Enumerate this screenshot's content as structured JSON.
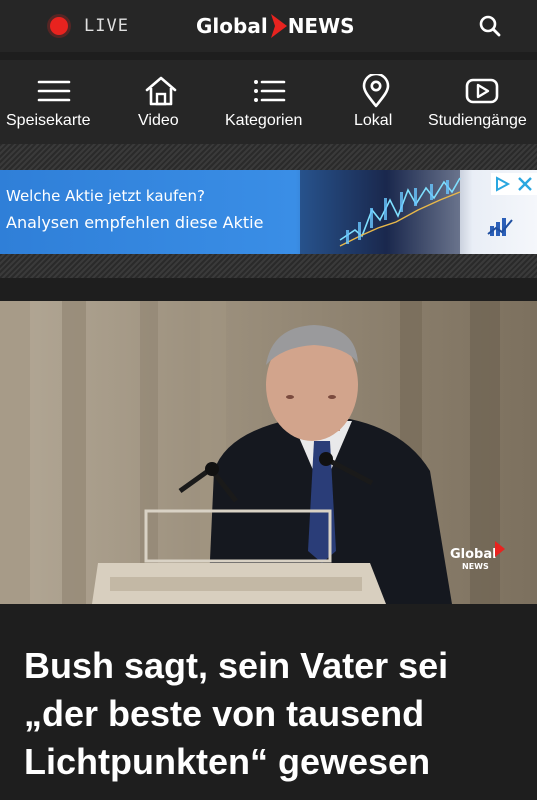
{
  "topbar": {
    "live_label": "LIVE",
    "logo": {
      "left": "Global",
      "right": "NEWS"
    },
    "search_icon": "search-icon"
  },
  "nav": {
    "items": [
      {
        "label": "Speisekarte",
        "icon": "hamburger-menu-icon"
      },
      {
        "label": "Video",
        "icon": "home-icon"
      },
      {
        "label": "Kategorien",
        "icon": "list-icon"
      },
      {
        "label": "Lokal",
        "icon": "location-pin-icon"
      },
      {
        "label": "Studiengänge",
        "icon": "play-icon"
      }
    ]
  },
  "ad": {
    "line1": "Welche Aktie jetzt kaufen?",
    "line2": "Analysen empfehlen diese Aktie",
    "choices_icon": "adchoices-icon",
    "close_icon": "close-icon"
  },
  "hero": {
    "watermark": {
      "left": "Global",
      "right": "NEWS"
    }
  },
  "article": {
    "headline_lines": [
      "Bush sagt, sein Vater sei",
      "„der beste von tausend",
      "Lichtpunkten“ gewesen"
    ]
  },
  "colors": {
    "live_red": "#e8231f",
    "brand_red": "#e8231f",
    "bar_bg": "#262626",
    "page_bg": "#1e1e1e",
    "ad_blue": "#2f7fd8"
  }
}
